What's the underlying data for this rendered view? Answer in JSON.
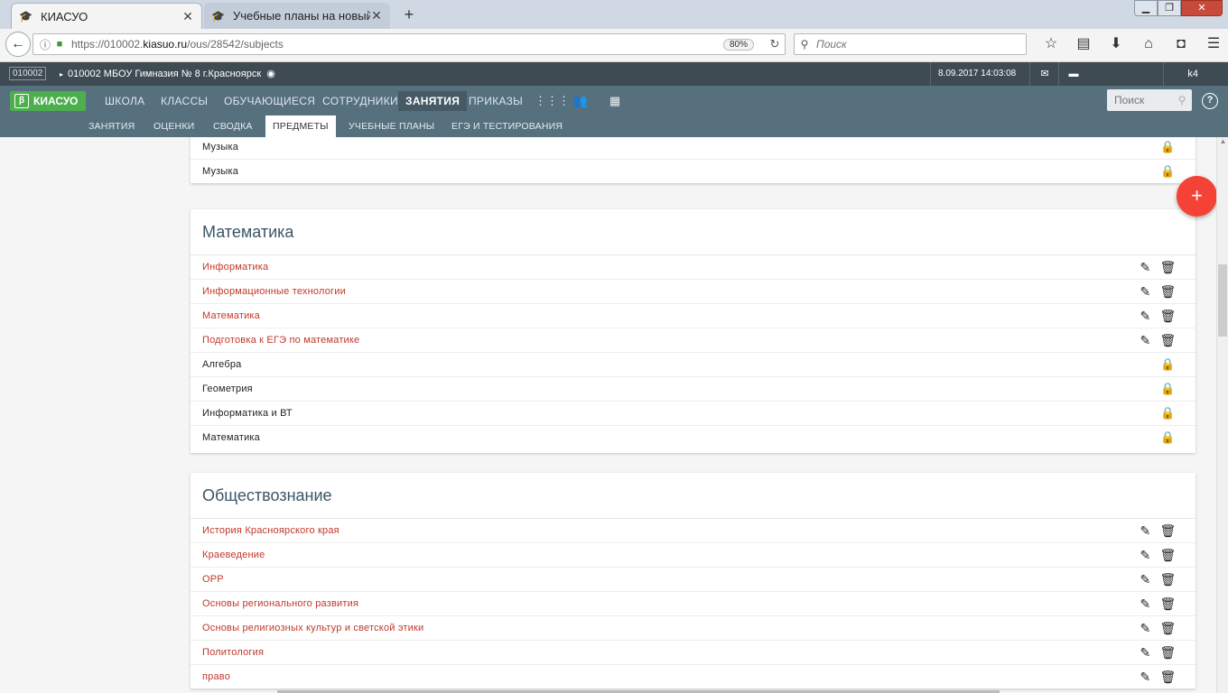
{
  "browser": {
    "tabs": [
      {
        "title": "КИАСУО",
        "active": true
      },
      {
        "title": "Учебные планы на новый у",
        "active": false
      }
    ],
    "new_tab": "+",
    "url_prefix": "https://010002.",
    "url_domain": "kiasuo.ru",
    "url_path": "/ous/28542/subjects",
    "zoom": "80%",
    "search_placeholder": "Поиск"
  },
  "header": {
    "org_code": "010002",
    "org_name": "010002 МБОУ Гимназия № 8 г.Красноярск",
    "datetime": "8.09.2017 14:03:08",
    "user": "k4"
  },
  "main_menu": {
    "logo": "КИАСУО",
    "logo_badge": "β",
    "items": [
      "ШКОЛА",
      "КЛАССЫ",
      "ОБУЧАЮЩИЕСЯ",
      "СОТРУДНИКИ",
      "ЗАНЯТИЯ",
      "ПРИКАЗЫ"
    ],
    "active": "ЗАНЯТИЯ",
    "search_placeholder": "Поиск",
    "help": "?"
  },
  "sub_menu": {
    "items": [
      "ЗАНЯТИЯ",
      "ОЦЕНКИ",
      "СВОДКА",
      "ПРЕДМЕТЫ",
      "УЧЕБНЫЕ ПЛАНЫ",
      "ЕГЭ И ТЕСТИРОВАНИЯ"
    ],
    "active": "ПРЕДМЕТЫ"
  },
  "sections": [
    {
      "title": "",
      "rows": [
        {
          "name": "Музыка",
          "editable": false
        },
        {
          "name": "Музыка",
          "editable": false
        }
      ]
    },
    {
      "title": "Математика",
      "rows": [
        {
          "name": "Информатика",
          "editable": true
        },
        {
          "name": "Информационные технологии",
          "editable": true
        },
        {
          "name": "Математика",
          "editable": true
        },
        {
          "name": "Подготовка к ЕГЭ по математике",
          "editable": true
        },
        {
          "name": "Алгебра",
          "editable": false
        },
        {
          "name": "Геометрия",
          "editable": false
        },
        {
          "name": "Информатика и ВТ",
          "editable": false
        },
        {
          "name": "Математика",
          "editable": false
        }
      ]
    },
    {
      "title": "Обществознание",
      "rows": [
        {
          "name": "История Красноярского края",
          "editable": true
        },
        {
          "name": "Краеведение",
          "editable": true
        },
        {
          "name": "ОРР",
          "editable": true
        },
        {
          "name": "Основы регионального развития",
          "editable": true
        },
        {
          "name": "Основы религиозных культур и светской этики",
          "editable": true
        },
        {
          "name": "Политология",
          "editable": true
        },
        {
          "name": "право",
          "editable": true
        }
      ]
    }
  ],
  "fab_label": "+",
  "colors": {
    "accent_link": "#c0392b",
    "menu_bg": "#56707e",
    "header_bg": "#3f4b53",
    "fab": "#f44336",
    "logo": "#4cae4c"
  }
}
